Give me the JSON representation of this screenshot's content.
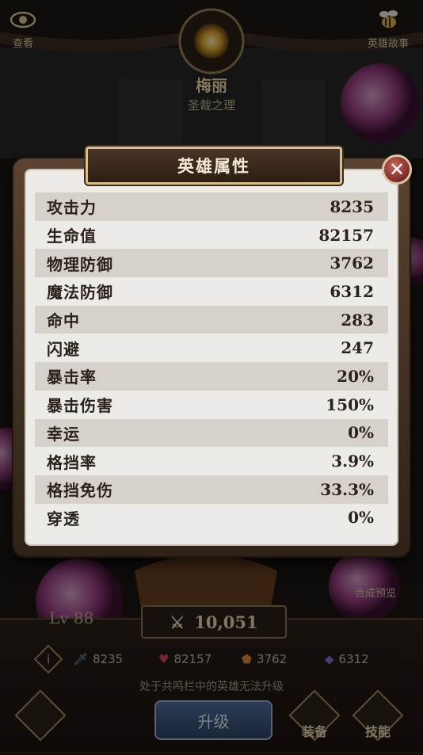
{
  "top_bar": {
    "view_label": "查看",
    "story_label": "英雄故事"
  },
  "hero": {
    "name": "梅丽",
    "title": "圣裁之理"
  },
  "modal": {
    "title": "英雄属性",
    "close_icon": "close-icon",
    "stats": [
      {
        "label": "攻击力",
        "value": "8235"
      },
      {
        "label": "生命值",
        "value": "82157"
      },
      {
        "label": "物理防御",
        "value": "3762"
      },
      {
        "label": "魔法防御",
        "value": "6312"
      },
      {
        "label": "命中",
        "value": "283"
      },
      {
        "label": "闪避",
        "value": "247"
      },
      {
        "label": "暴击率",
        "value": "20%"
      },
      {
        "label": "暴击伤害",
        "value": "150%"
      },
      {
        "label": "幸运",
        "value": "0%"
      },
      {
        "label": "格挡率",
        "value": "3.9%"
      },
      {
        "label": "格挡免伤",
        "value": "33.3%"
      },
      {
        "label": "穿透",
        "value": "0%"
      }
    ]
  },
  "hud": {
    "level": "Lv 88",
    "power": "10,051",
    "merge_preview": "合成预览",
    "mini_stats": {
      "attack": "8235",
      "hp": "82157",
      "pdef": "3762",
      "mdef": "6312"
    },
    "notice": "处于共鸣栏中的英雄无法升级",
    "upgrade_label": "升级",
    "equip_label": "装备",
    "skill_label": "技能"
  },
  "colors": {
    "panel_bg": "#ecebe7",
    "row_alt": "#d6d2cb",
    "title_plate": "#3a281c",
    "gold_trim": "#d8c08a",
    "close_red": "#9c3a31"
  }
}
